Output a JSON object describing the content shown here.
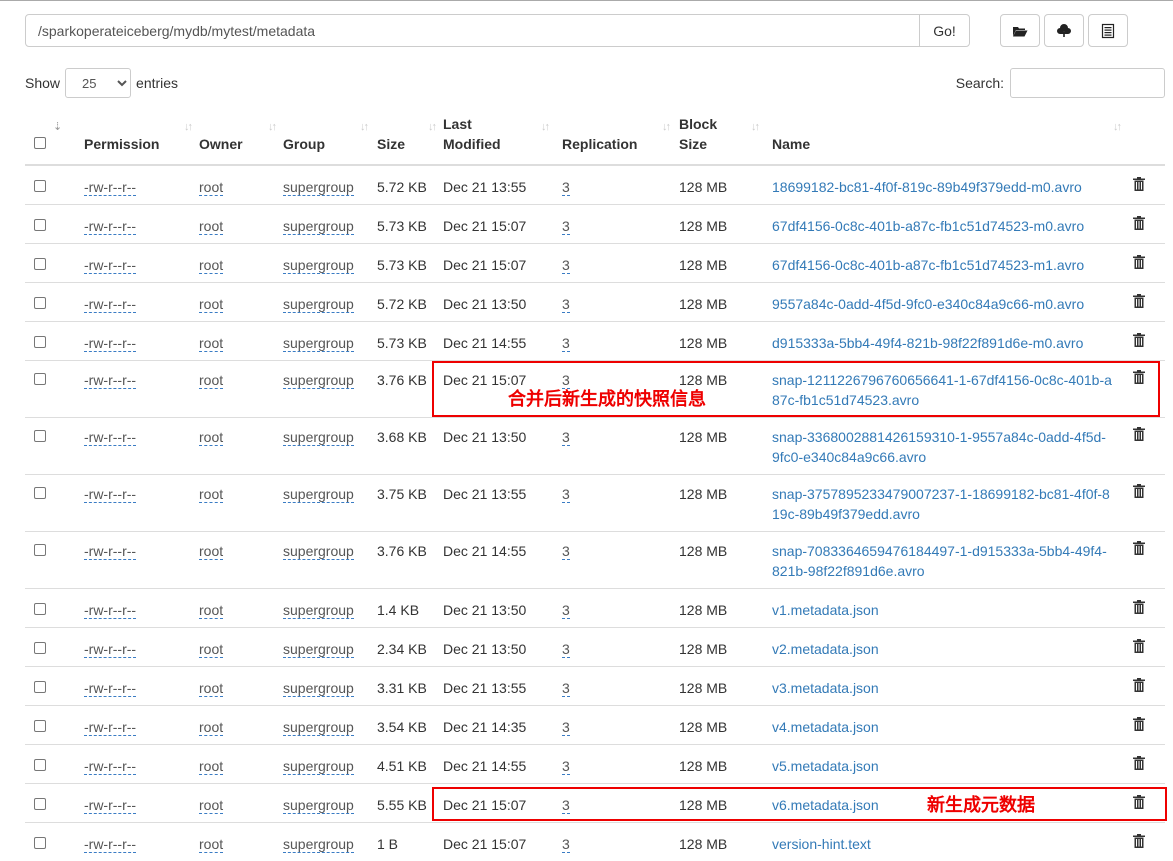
{
  "pathbar": {
    "value": "/sparkoperateiceberg/mydb/mytest/metadata",
    "go_label": "Go!"
  },
  "toolbar": {
    "icons": [
      "folder-open-icon",
      "cloud-upload-icon",
      "list-alt-icon"
    ]
  },
  "length": {
    "show_label": "Show",
    "selected": "25",
    "entries_label": "entries"
  },
  "search": {
    "label": "Search:",
    "value": ""
  },
  "columns": [
    "",
    "Permission",
    "Owner",
    "Group",
    "Size",
    "Last Modified",
    "Replication",
    "Block Size",
    "Name"
  ],
  "header": {
    "permission": "Permission",
    "owner": "Owner",
    "group": "Group",
    "size": "Size",
    "last_modified_1": "Last",
    "last_modified_2": "Modified",
    "replication": "Replication",
    "block_size_1": "Block",
    "block_size_2": "Size",
    "name": "Name"
  },
  "rows": [
    {
      "perm": "-rw-r--r--",
      "owner": "root",
      "group": "supergroup",
      "size": "5.72 KB",
      "modified": "Dec 21 13:55",
      "repl": "3",
      "block": "128 MB",
      "name": "18699182-bc81-4f0f-819c-89b49f379edd-m0.avro"
    },
    {
      "perm": "-rw-r--r--",
      "owner": "root",
      "group": "supergroup",
      "size": "5.73 KB",
      "modified": "Dec 21 15:07",
      "repl": "3",
      "block": "128 MB",
      "name": "67df4156-0c8c-401b-a87c-fb1c51d74523-m0.avro"
    },
    {
      "perm": "-rw-r--r--",
      "owner": "root",
      "group": "supergroup",
      "size": "5.73 KB",
      "modified": "Dec 21 15:07",
      "repl": "3",
      "block": "128 MB",
      "name": "67df4156-0c8c-401b-a87c-fb1c51d74523-m1.avro"
    },
    {
      "perm": "-rw-r--r--",
      "owner": "root",
      "group": "supergroup",
      "size": "5.72 KB",
      "modified": "Dec 21 13:50",
      "repl": "3",
      "block": "128 MB",
      "name": "9557a84c-0add-4f5d-9fc0-e340c84a9c66-m0.avro"
    },
    {
      "perm": "-rw-r--r--",
      "owner": "root",
      "group": "supergroup",
      "size": "5.73 KB",
      "modified": "Dec 21 14:55",
      "repl": "3",
      "block": "128 MB",
      "name": "d915333a-5bb4-49f4-821b-98f22f891d6e-m0.avro"
    },
    {
      "perm": "-rw-r--r--",
      "owner": "root",
      "group": "supergroup",
      "size": "3.76 KB",
      "modified": "Dec 21 15:07",
      "repl": "3",
      "block": "128 MB",
      "name": "snap-1211226796760656641-1-67df4156-0c8c-401b-a87c-fb1c51d74523.avro"
    },
    {
      "perm": "-rw-r--r--",
      "owner": "root",
      "group": "supergroup",
      "size": "3.68 KB",
      "modified": "Dec 21 13:50",
      "repl": "3",
      "block": "128 MB",
      "name": "snap-3368002881426159310-1-9557a84c-0add-4f5d-9fc0-e340c84a9c66.avro"
    },
    {
      "perm": "-rw-r--r--",
      "owner": "root",
      "group": "supergroup",
      "size": "3.75 KB",
      "modified": "Dec 21 13:55",
      "repl": "3",
      "block": "128 MB",
      "name": "snap-3757895233479007237-1-18699182-bc81-4f0f-819c-89b49f379edd.avro"
    },
    {
      "perm": "-rw-r--r--",
      "owner": "root",
      "group": "supergroup",
      "size": "3.76 KB",
      "modified": "Dec 21 14:55",
      "repl": "3",
      "block": "128 MB",
      "name": "snap-7083364659476184497-1-d915333a-5bb4-49f4-821b-98f22f891d6e.avro"
    },
    {
      "perm": "-rw-r--r--",
      "owner": "root",
      "group": "supergroup",
      "size": "1.4 KB",
      "modified": "Dec 21 13:50",
      "repl": "3",
      "block": "128 MB",
      "name": "v1.metadata.json"
    },
    {
      "perm": "-rw-r--r--",
      "owner": "root",
      "group": "supergroup",
      "size": "2.34 KB",
      "modified": "Dec 21 13:50",
      "repl": "3",
      "block": "128 MB",
      "name": "v2.metadata.json"
    },
    {
      "perm": "-rw-r--r--",
      "owner": "root",
      "group": "supergroup",
      "size": "3.31 KB",
      "modified": "Dec 21 13:55",
      "repl": "3",
      "block": "128 MB",
      "name": "v3.metadata.json"
    },
    {
      "perm": "-rw-r--r--",
      "owner": "root",
      "group": "supergroup",
      "size": "3.54 KB",
      "modified": "Dec 21 14:35",
      "repl": "3",
      "block": "128 MB",
      "name": "v4.metadata.json"
    },
    {
      "perm": "-rw-r--r--",
      "owner": "root",
      "group": "supergroup",
      "size": "4.51 KB",
      "modified": "Dec 21 14:55",
      "repl": "3",
      "block": "128 MB",
      "name": "v5.metadata.json"
    },
    {
      "perm": "-rw-r--r--",
      "owner": "root",
      "group": "supergroup",
      "size": "5.55 KB",
      "modified": "Dec 21 15:07",
      "repl": "3",
      "block": "128 MB",
      "name": "v6.metadata.json"
    },
    {
      "perm": "-rw-r--r--",
      "owner": "root",
      "group": "supergroup",
      "size": "1 B",
      "modified": "Dec 21 15:07",
      "repl": "3",
      "block": "128 MB",
      "name": "version-hint.text"
    }
  ],
  "annotations": {
    "snapshot_note": "合并后新生成的快照信息",
    "metadata_note": "新生成元数据",
    "color": "#e00000"
  },
  "colors": {
    "link": "#337ab7",
    "border": "#dddddd"
  }
}
